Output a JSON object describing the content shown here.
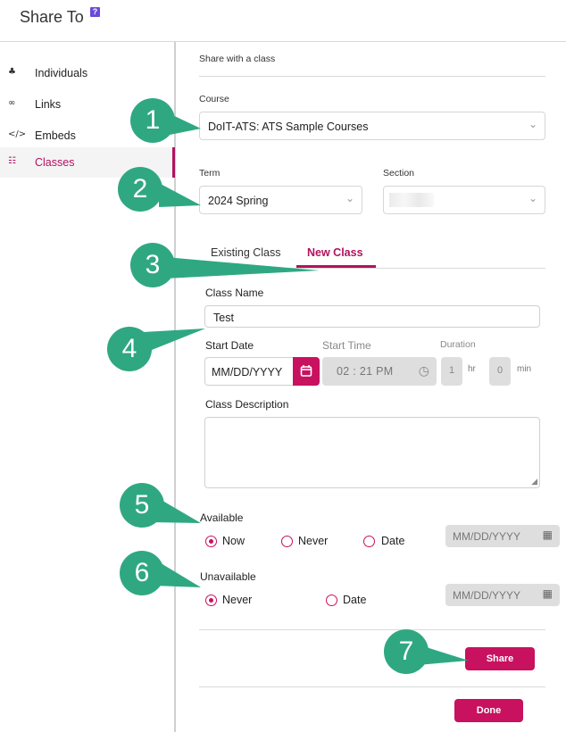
{
  "header": {
    "title": "Share To",
    "help_icon": "?"
  },
  "sidebar": {
    "items": [
      {
        "icon": "users-icon",
        "glyph": "♣",
        "label": "Individuals",
        "active": false
      },
      {
        "icon": "link-icon",
        "glyph": "∞",
        "label": "Links",
        "active": false
      },
      {
        "icon": "code-icon",
        "glyph": "</>",
        "label": "Embeds",
        "active": false
      },
      {
        "icon": "classroom-icon",
        "glyph": "☷",
        "label": "Classes",
        "active": true
      }
    ]
  },
  "main": {
    "section_title": "Share with a class",
    "course": {
      "label": "Course",
      "value": "DoIT-ATS: ATS Sample Courses"
    },
    "term": {
      "label": "Term",
      "value": "2024 Spring"
    },
    "section": {
      "label": "Section",
      "value": ""
    },
    "tabs": [
      {
        "label": "Existing Class",
        "active": false
      },
      {
        "label": "New Class",
        "active": true
      }
    ],
    "class_name": {
      "label": "Class Name",
      "value": "Test"
    },
    "start_date": {
      "label": "Start Date",
      "placeholder": "MM/DD/YYYY"
    },
    "start_time": {
      "label": "Start Time",
      "value": "02 : 21  PM"
    },
    "duration": {
      "label": "Duration",
      "hours": "1",
      "hours_unit": "hr",
      "minutes": "0",
      "minutes_unit": "min"
    },
    "class_description": {
      "label": "Class Description",
      "value": ""
    },
    "available": {
      "label": "Available",
      "options": [
        "Now",
        "Never",
        "Date"
      ],
      "selected": "Now",
      "date_placeholder": "MM/DD/YYYY"
    },
    "unavailable": {
      "label": "Unavailable",
      "options": [
        "Never",
        "Date"
      ],
      "selected": "Never",
      "date_placeholder": "MM/DD/YYYY"
    },
    "share_label": "Share",
    "done_label": "Done"
  },
  "callouts": [
    "1",
    "2",
    "3",
    "4",
    "5",
    "6",
    "7"
  ],
  "colors": {
    "accent": "#c8115f",
    "callout": "#2fa882"
  }
}
